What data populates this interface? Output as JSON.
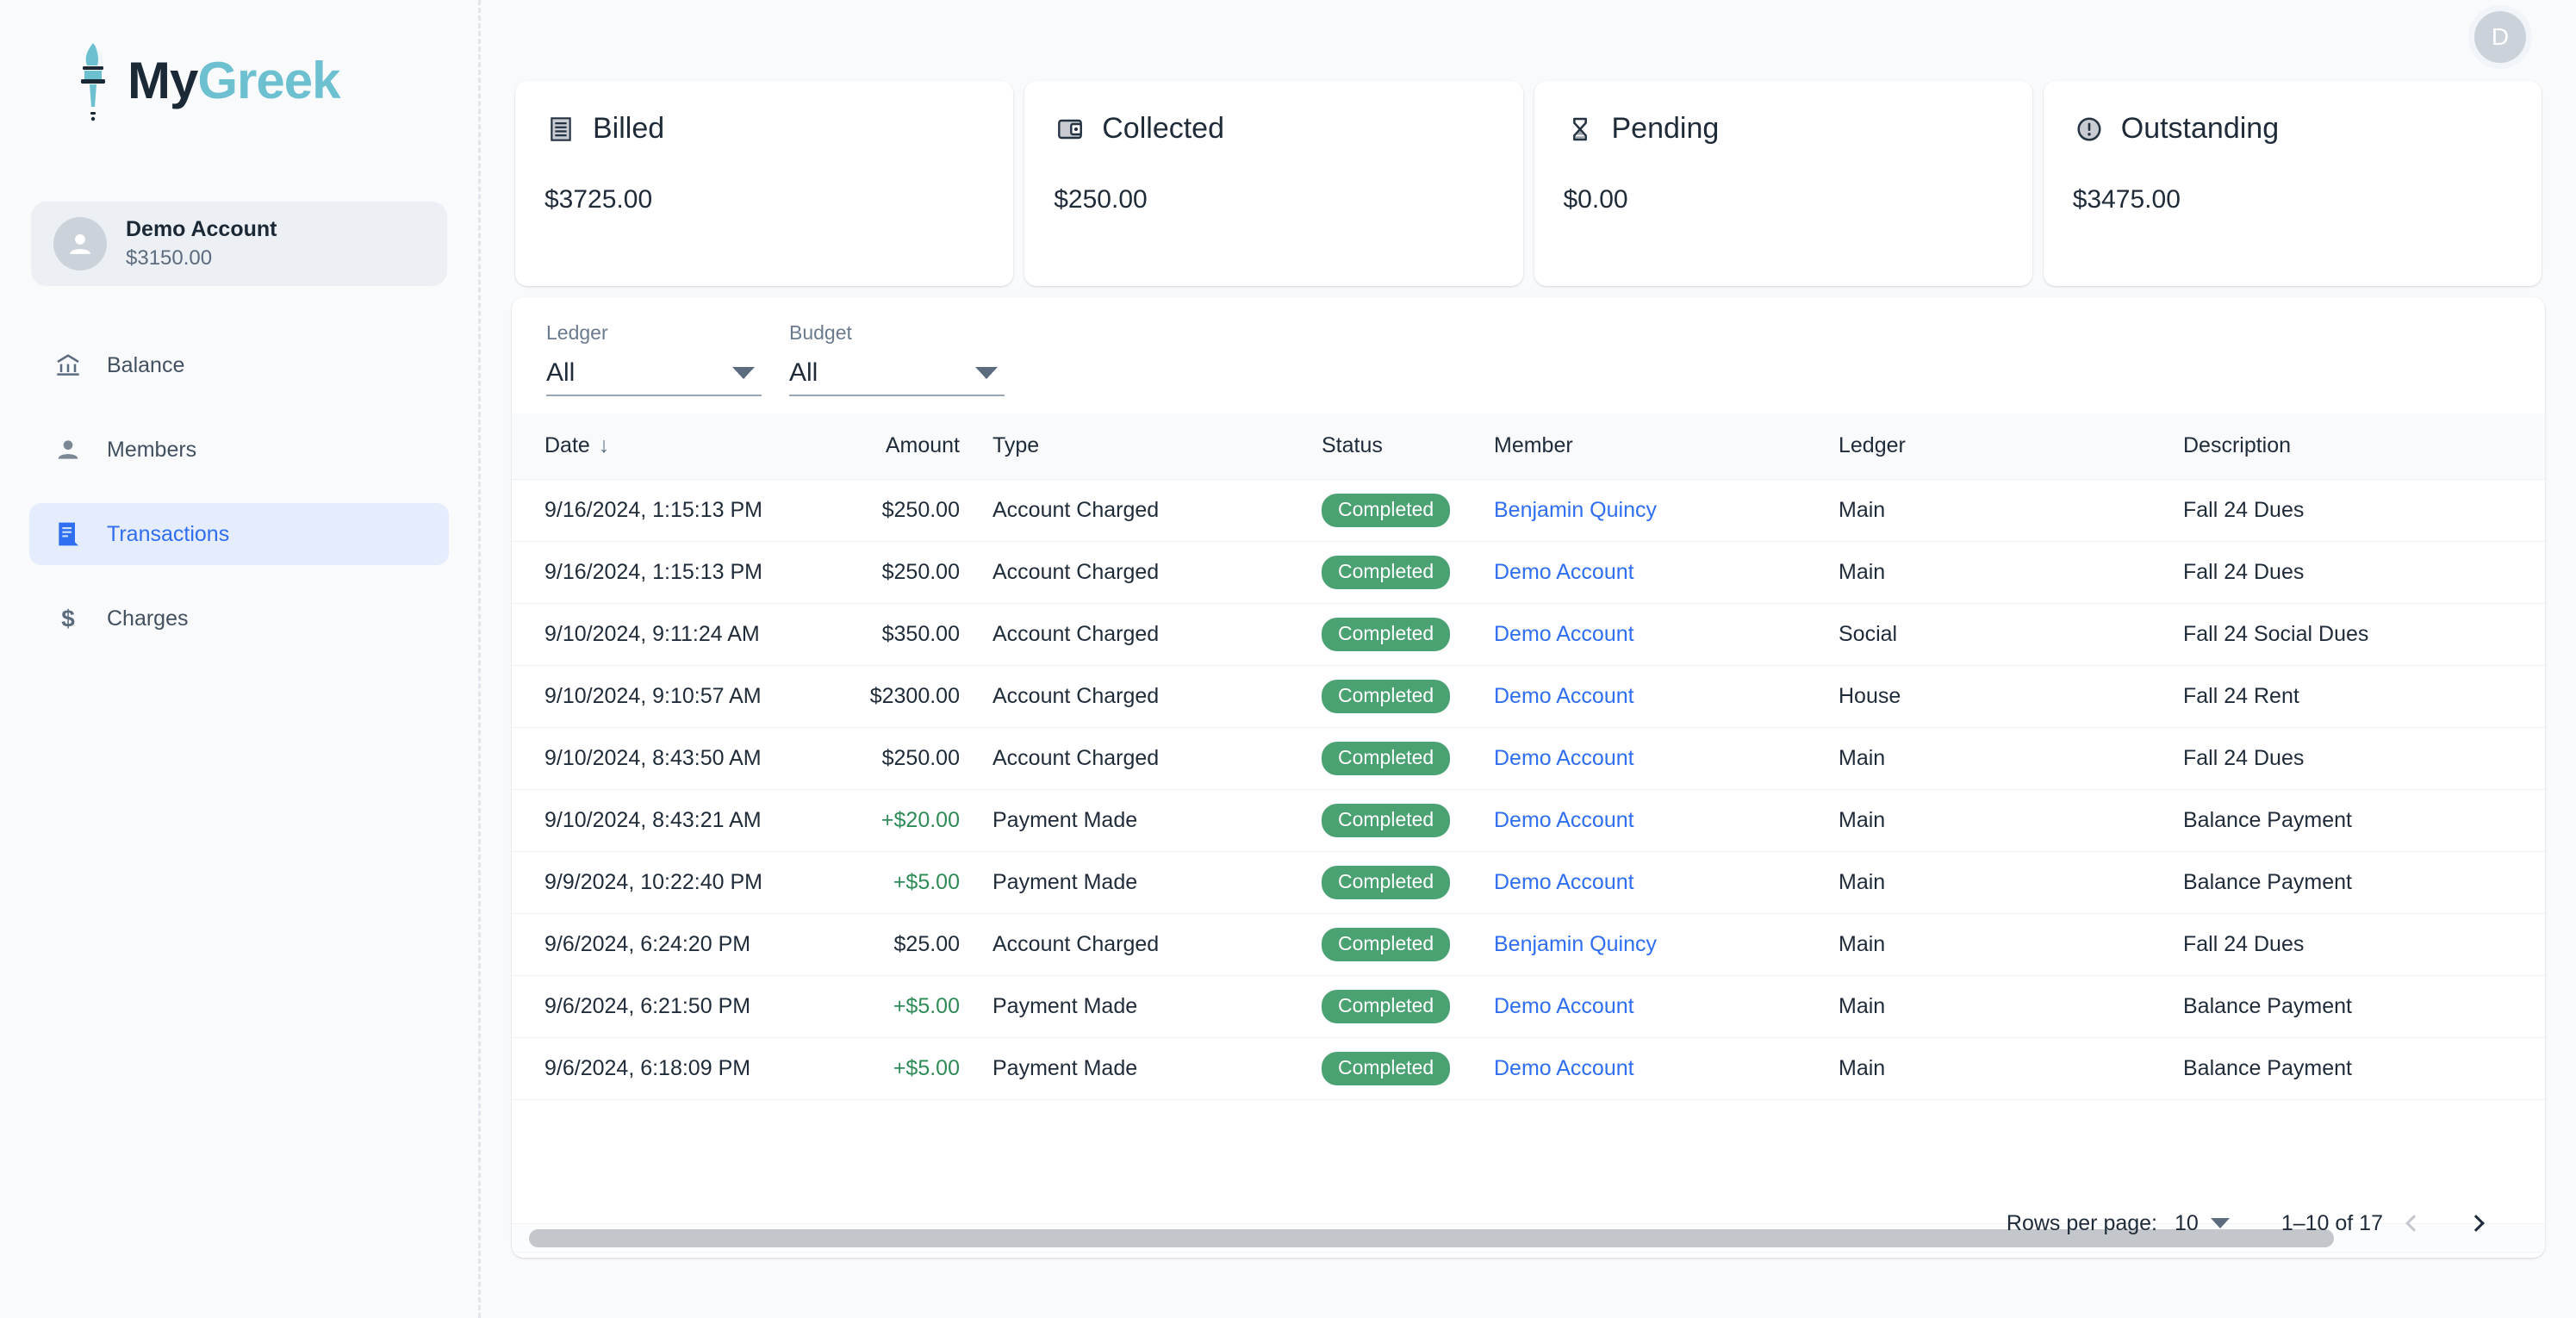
{
  "brand": {
    "name_first": "My",
    "name_second": "Greek",
    "logo_icon": "torch-icon"
  },
  "sidebar": {
    "account": {
      "name": "Demo Account",
      "balance": "$3150.00",
      "avatar_icon": "person-icon"
    },
    "items": [
      {
        "label": "Balance",
        "icon": "bank-icon",
        "active": false
      },
      {
        "label": "Members",
        "icon": "person-icon",
        "active": false
      },
      {
        "label": "Transactions",
        "icon": "receipt-icon",
        "active": true
      },
      {
        "label": "Charges",
        "icon": "dollar-icon",
        "active": false
      }
    ]
  },
  "topbar": {
    "avatar_initial": "D"
  },
  "stats": [
    {
      "title": "Billed",
      "value": "$3725.00",
      "icon": "receipt-icon"
    },
    {
      "title": "Collected",
      "value": "$250.00",
      "icon": "wallet-icon"
    },
    {
      "title": "Pending",
      "value": "$0.00",
      "icon": "hourglass-icon"
    },
    {
      "title": "Outstanding",
      "value": "$3475.00",
      "icon": "alert-circle-icon"
    }
  ],
  "filters": [
    {
      "label": "Ledger",
      "value": "All"
    },
    {
      "label": "Budget",
      "value": "All"
    }
  ],
  "table": {
    "columns": [
      {
        "key": "date",
        "label": "Date",
        "sorted": true,
        "sort_dir": "desc",
        "sort_glyph": "↓"
      },
      {
        "key": "amount",
        "label": "Amount"
      },
      {
        "key": "type",
        "label": "Type"
      },
      {
        "key": "status",
        "label": "Status"
      },
      {
        "key": "member",
        "label": "Member"
      },
      {
        "key": "ledger",
        "label": "Ledger"
      },
      {
        "key": "description",
        "label": "Description"
      }
    ],
    "rows": [
      {
        "date": "9/16/2024, 1:15:13 PM",
        "amount": "$250.00",
        "positive": false,
        "type": "Account Charged",
        "status": "Completed",
        "member": "Benjamin Quincy",
        "ledger": "Main",
        "description": "Fall 24 Dues"
      },
      {
        "date": "9/16/2024, 1:15:13 PM",
        "amount": "$250.00",
        "positive": false,
        "type": "Account Charged",
        "status": "Completed",
        "member": "Demo Account",
        "ledger": "Main",
        "description": "Fall 24 Dues"
      },
      {
        "date": "9/10/2024, 9:11:24 AM",
        "amount": "$350.00",
        "positive": false,
        "type": "Account Charged",
        "status": "Completed",
        "member": "Demo Account",
        "ledger": "Social",
        "description": "Fall 24 Social Dues"
      },
      {
        "date": "9/10/2024, 9:10:57 AM",
        "amount": "$2300.00",
        "positive": false,
        "type": "Account Charged",
        "status": "Completed",
        "member": "Demo Account",
        "ledger": "House",
        "description": "Fall 24 Rent"
      },
      {
        "date": "9/10/2024, 8:43:50 AM",
        "amount": "$250.00",
        "positive": false,
        "type": "Account Charged",
        "status": "Completed",
        "member": "Demo Account",
        "ledger": "Main",
        "description": "Fall 24 Dues"
      },
      {
        "date": "9/10/2024, 8:43:21 AM",
        "amount": "+$20.00",
        "positive": true,
        "type": "Payment Made",
        "status": "Completed",
        "member": "Demo Account",
        "ledger": "Main",
        "description": "Balance Payment"
      },
      {
        "date": "9/9/2024, 10:22:40 PM",
        "amount": "+$5.00",
        "positive": true,
        "type": "Payment Made",
        "status": "Completed",
        "member": "Demo Account",
        "ledger": "Main",
        "description": "Balance Payment"
      },
      {
        "date": "9/6/2024, 6:24:20 PM",
        "amount": "$25.00",
        "positive": false,
        "type": "Account Charged",
        "status": "Completed",
        "member": "Benjamin Quincy",
        "ledger": "Main",
        "description": "Fall 24 Dues"
      },
      {
        "date": "9/6/2024, 6:21:50 PM",
        "amount": "+$5.00",
        "positive": true,
        "type": "Payment Made",
        "status": "Completed",
        "member": "Demo Account",
        "ledger": "Main",
        "description": "Balance Payment"
      },
      {
        "date": "9/6/2024, 6:18:09 PM",
        "amount": "+$5.00",
        "positive": true,
        "type": "Payment Made",
        "status": "Completed",
        "member": "Demo Account",
        "ledger": "Main",
        "description": "Balance Payment"
      }
    ]
  },
  "pagination": {
    "rows_per_page_label": "Rows per page:",
    "rows_per_page_value": "10",
    "range": "1–10 of 17",
    "prev_icon": "chevron-left-icon",
    "next_icon": "chevron-right-icon"
  },
  "colors": {
    "accent_blue": "#2f6ef0",
    "brand_teal": "#6cc0d0",
    "brand_dark": "#1b2836",
    "status_green": "#4aa273",
    "amount_positive": "#2e8b57"
  }
}
